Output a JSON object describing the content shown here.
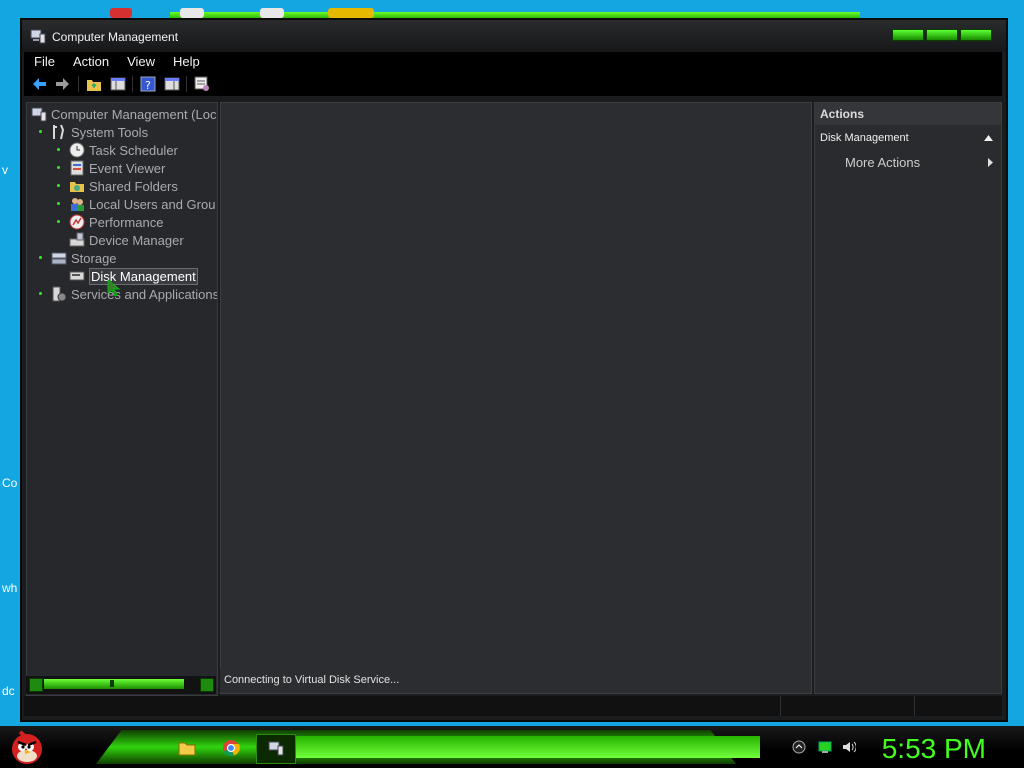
{
  "window": {
    "title": "Computer Management"
  },
  "menu": [
    "File",
    "Action",
    "View",
    "Help"
  ],
  "tree": {
    "root": "Computer Management (Loc",
    "items": [
      {
        "label": "System Tools",
        "icon": "tools-icon"
      },
      {
        "label": "Task Scheduler",
        "icon": "clock-icon"
      },
      {
        "label": "Event Viewer",
        "icon": "event-viewer-icon"
      },
      {
        "label": "Shared Folders",
        "icon": "shared-folder-icon"
      },
      {
        "label": "Local Users and Grou",
        "icon": "users-icon"
      },
      {
        "label": "Performance",
        "icon": "performance-icon"
      },
      {
        "label": "Device Manager",
        "icon": "device-manager-icon"
      },
      {
        "label": "Storage",
        "icon": "storage-icon"
      },
      {
        "label": "Disk Management",
        "icon": "disk-icon"
      },
      {
        "label": "Services and Applications",
        "icon": "services-icon"
      }
    ]
  },
  "center": {
    "status": "Connecting to Virtual Disk Service..."
  },
  "actions": {
    "header": "Actions",
    "section": "Disk Management",
    "more": "More Actions"
  },
  "taskbar": {
    "clock": "5:53 PM"
  },
  "desktop_fragments": [
    "v",
    "Co",
    "wh",
    "dc"
  ]
}
